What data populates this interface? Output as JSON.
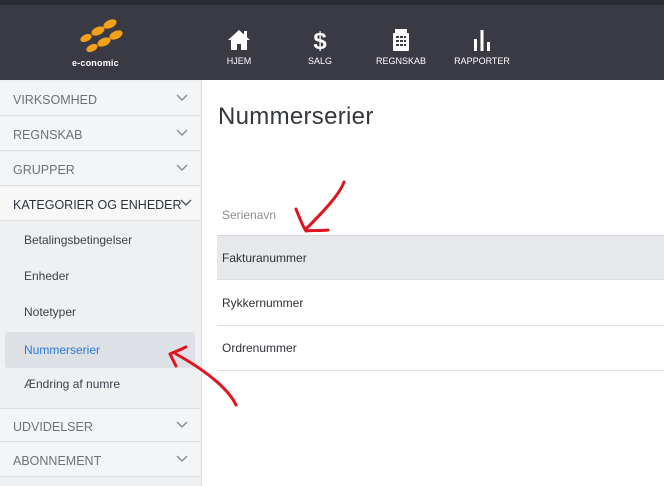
{
  "app": {
    "logo_text": "e-conomic"
  },
  "header": {
    "nav": [
      {
        "label": "HJEM",
        "icon": "home-icon"
      },
      {
        "label": "SALG",
        "icon": "dollar-icon"
      },
      {
        "label": "REGNSKAB",
        "icon": "calculator-icon"
      },
      {
        "label": "RAPPORTER",
        "icon": "bar-chart-icon"
      }
    ]
  },
  "sidebar": {
    "sections": [
      {
        "label": "VIRKSOMHED"
      },
      {
        "label": "REGNSKAB"
      },
      {
        "label": "GRUPPER"
      },
      {
        "label": "KATEGORIER OG ENHEDER"
      },
      {
        "label": "UDVIDELSER"
      },
      {
        "label": "ABONNEMENT"
      }
    ],
    "subitems": [
      {
        "label": "Betalingsbetingelser"
      },
      {
        "label": "Enheder"
      },
      {
        "label": "Notetyper"
      },
      {
        "label": "Nummerserier"
      },
      {
        "label": "Ændring af numre"
      }
    ]
  },
  "main": {
    "title": "Nummerserier",
    "column_header": "Serienavn",
    "rows": [
      {
        "label": "Fakturanummer"
      },
      {
        "label": "Rykkernummer"
      },
      {
        "label": "Ordrenummer"
      }
    ]
  },
  "colors": {
    "header_bg": "#3a3a44",
    "accent_blue": "#2b78d8",
    "logo_orange": "#f5a01a",
    "annotation_red": "#e0141e"
  }
}
